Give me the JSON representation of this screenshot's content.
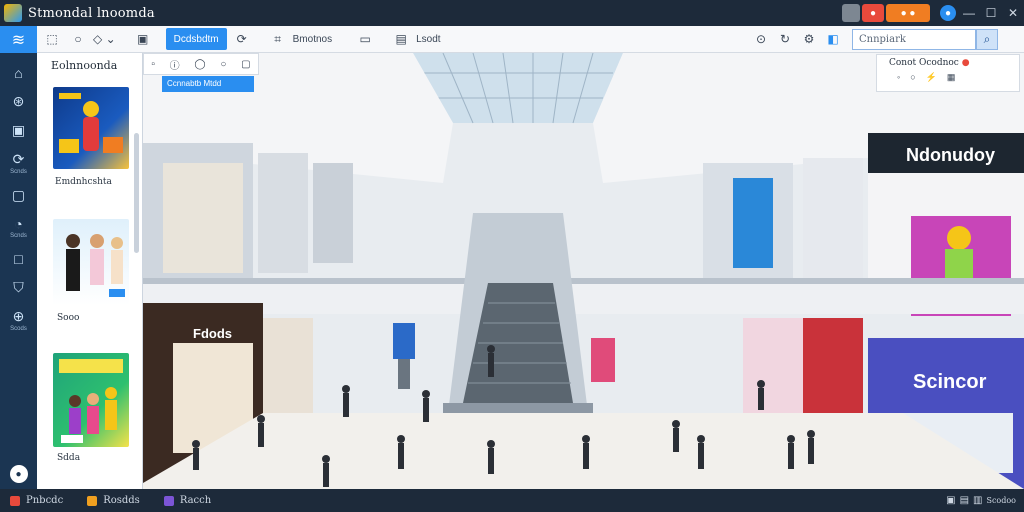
{
  "app": {
    "title": "Stmondal lnoomda"
  },
  "toolbar": {
    "tab_active": "Dcdsbdtm",
    "tool_label": "Bmotnos",
    "tool_label2": "Lsodt",
    "search_placeholder": "Cnnpiark"
  },
  "subtools": {
    "breadcrumb": "Ccnnabtb Mtdd"
  },
  "panel": {
    "title": "Eolnnoonda",
    "items": [
      {
        "caption": "Emdnhcshta"
      },
      {
        "caption": "Sooo"
      },
      {
        "caption": "Sdda"
      }
    ]
  },
  "properties": {
    "title": "Conot Ocodnoc"
  },
  "rail": {
    "labels": [
      "Scnds",
      "Scnds",
      "Scods"
    ]
  },
  "statusbar": {
    "items": [
      {
        "label": "Pnbcdc",
        "color": "#4aa3f0"
      },
      {
        "label": "Rosdds",
        "color": "#f0a020"
      },
      {
        "label": "Racch",
        "color": "#7c55d6"
      }
    ],
    "right_label": "Scodoo"
  },
  "scene": {
    "store_sign_top_right": "Ndonudoy",
    "store_sign_right": "Scincor",
    "store_sign_lower_left": "Fdods"
  },
  "colors": {
    "accent": "#2a8ef0",
    "titlebar": "#1d2a3a",
    "rail": "#1b3552"
  }
}
